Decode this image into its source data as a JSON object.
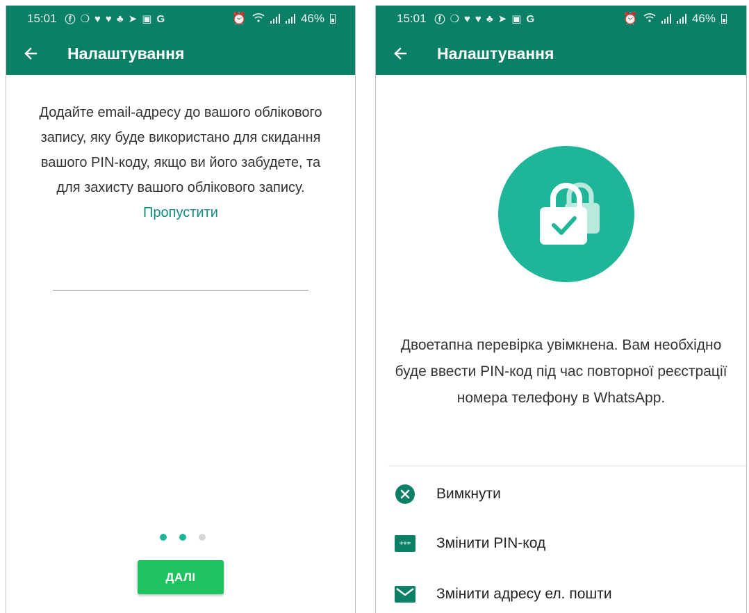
{
  "colors": {
    "primary": "#0b8066",
    "accent": "#1fb598",
    "link": "#128c7e",
    "button": "#1ec25f"
  },
  "status_bar": {
    "time": "15:01",
    "battery": "46%",
    "notification_icons": [
      "facebook-icon",
      "facebook-messenger-icon",
      "twitter-icon",
      "twitter-icon",
      "game-icon",
      "telegram-icon",
      "gallery-icon",
      "google-icon"
    ],
    "system_icons": [
      "alarm-icon",
      "wifi-icon",
      "signal-icon",
      "signal-icon",
      "battery-icon"
    ]
  },
  "left_screen": {
    "title": "Налаштування",
    "description": "Додайте email-адресу до вашого облікового запису, яку буде використано для скидання вашого PIN-коду, якщо ви його забудете, та для захисту вашого облікового запису.",
    "skip_link": "Пропустити",
    "email_value": "",
    "pager": {
      "total": 3,
      "active": [
        0,
        1
      ]
    },
    "next_button": "ДАЛІ"
  },
  "right_screen": {
    "title": "Налаштування",
    "status_text": "Двоетапна перевірка увімкнена. Вам необхідно буде ввести PIN-код під час повторної реєстрації номера телефону в WhatsApp.",
    "menu": [
      {
        "icon": "close-circle-icon",
        "label": "Вимкнути"
      },
      {
        "icon": "pin-code-icon",
        "label": "Змінити PIN-код"
      },
      {
        "icon": "email-icon",
        "label": "Змінити адресу ел. пошти"
      }
    ]
  }
}
